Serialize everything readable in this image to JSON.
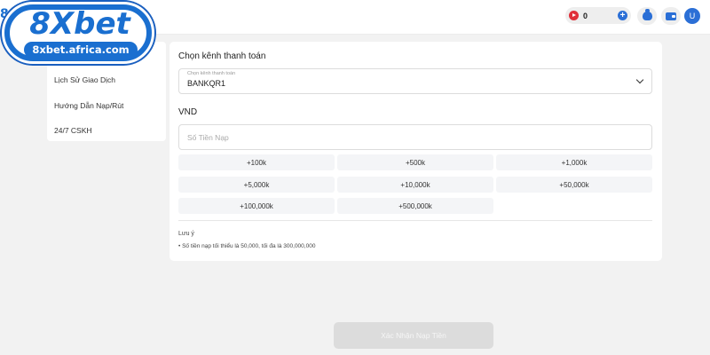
{
  "logo": {
    "wordmark": "8Xbet",
    "url": "8xbet.africa.com",
    "peek": "8"
  },
  "header": {
    "balance": "0",
    "avatar_initial": "U"
  },
  "sidebar": {
    "items": [
      {
        "label": "Lịch Sử Giao Dịch"
      },
      {
        "label": "Hướng Dẫn Nạp/Rút"
      },
      {
        "label": "24/7 CSKH"
      }
    ]
  },
  "main": {
    "channel_title": "Chọn kênh thanh toán",
    "channel_select": {
      "label": "Chọn kênh thanh toán",
      "value": "BANKQR1"
    },
    "currency": "VND",
    "amount_input": {
      "placeholder": "Số Tiền Nạp",
      "value": ""
    },
    "quick_amounts": [
      "+100k",
      "+500k",
      "+1,000k",
      "+5,000k",
      "+10,000k",
      "+50,000k",
      "+100,000k",
      "+500,000k"
    ],
    "note_title": "Lưu ý",
    "note_items": [
      "Số tiền nạp tối thiểu là 50,000, tối đa là 300,000,000"
    ]
  },
  "confirm_button": "Xác Nhận Nạp Tiền",
  "colors": {
    "accent": "#2b6fd6",
    "logo_blue": "#1a6fd0",
    "coin_red": "#e0303a",
    "disabled_button": "#dcdcdc",
    "background": "#f2f2f2"
  },
  "icons": [
    "coin-icon",
    "plus-icon",
    "moneybag-icon",
    "wallet-icon",
    "chevron-down-icon"
  ]
}
